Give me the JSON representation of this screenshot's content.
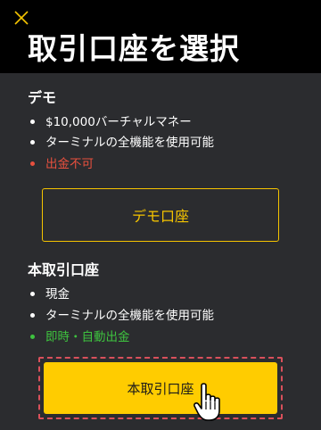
{
  "header": {
    "title": "取引口座を選択",
    "close_icon": "close-icon"
  },
  "demo": {
    "section_title": "デモ",
    "features": [
      {
        "text": "$10,000バーチャルマネー",
        "status": "normal"
      },
      {
        "text": "ターミナルの全機能を使用可能",
        "status": "normal"
      },
      {
        "text": "出金不可",
        "status": "negative"
      }
    ],
    "button_label": "デモ口座"
  },
  "real": {
    "section_title": "本取引口座",
    "features": [
      {
        "text": "現金",
        "status": "normal"
      },
      {
        "text": "ターミナルの全機能を使用可能",
        "status": "normal"
      },
      {
        "text": "即時・自動出金",
        "status": "positive"
      }
    ],
    "button_label": "本取引口座"
  },
  "colors": {
    "background": "#2b2c2f",
    "header_background": "#000000",
    "accent_yellow": "#ffcc00",
    "negative_red": "#e8503e",
    "positive_green": "#3ec33f",
    "focus_outline": "#d9505b"
  },
  "cursor_icon": "hand-pointer-icon"
}
